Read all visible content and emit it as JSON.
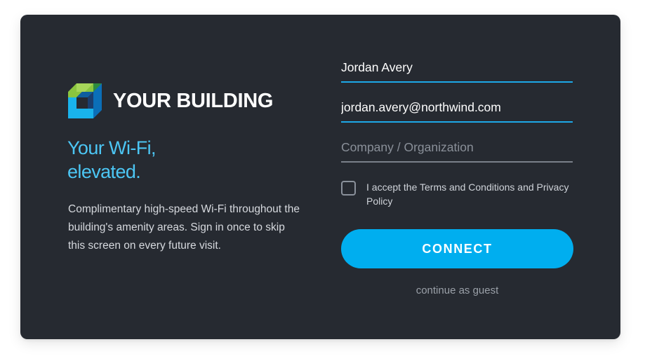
{
  "brand": {
    "name": "YOUR BUILDING",
    "logo_icon": "building-cube-logo-icon",
    "colors": {
      "logo_light_green": "#8bc53f",
      "logo_dark_green": "#2e8b3e",
      "logo_light_blue": "#19b3ec",
      "logo_dark_blue": "#0b6fb8"
    }
  },
  "hero": {
    "tagline_line1": "Your Wi-Fi,",
    "tagline_line2": "elevated.",
    "description": "Complimentary high-speed Wi-Fi throughout the building's amenity areas. Sign in once to skip this screen on every future visit."
  },
  "form": {
    "name": {
      "value": "Jordan Avery",
      "placeholder": ""
    },
    "email": {
      "value": "jordan.avery@northwind.com",
      "placeholder": ""
    },
    "company": {
      "value": "",
      "placeholder": "Company / Organization"
    },
    "terms_label": "I accept the Terms and Conditions and Privacy Policy",
    "terms_checked": false,
    "connect_label": "CONNECT",
    "guest_label": "continue as guest"
  },
  "colors": {
    "card_bg": "#262a31",
    "accent": "#00aeef",
    "tagline": "#4cc6f4",
    "field_active_underline": "#1da9e8",
    "field_inactive_underline": "#7a808a"
  }
}
